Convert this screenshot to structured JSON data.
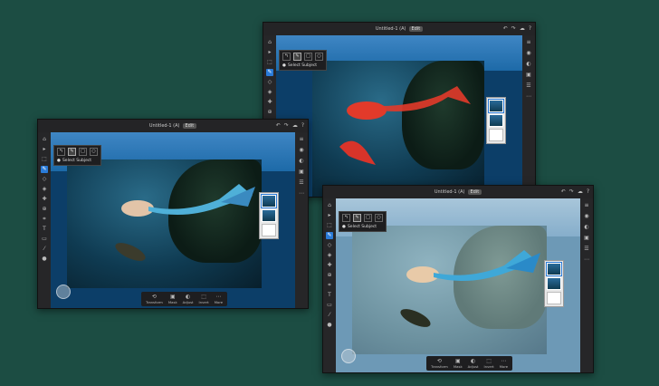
{
  "windows": [
    {
      "title": "Untitled-1 (A)",
      "badge": "Edit",
      "popup_label": "Select Subject",
      "bottom": [
        {
          "icon": "⟲",
          "label": "Transform"
        },
        {
          "icon": "▣",
          "label": "Mask"
        },
        {
          "icon": "◐",
          "label": "Adjust"
        },
        {
          "icon": "⬚",
          "label": "Invert"
        },
        {
          "icon": "⋯",
          "label": "More"
        }
      ]
    },
    {
      "title": "Untitled-1 (A)",
      "badge": "Edit",
      "popup_label": "Select Subject"
    },
    {
      "title": "Untitled-1 (A)",
      "badge": "Edit",
      "popup_label": "Select Subject",
      "bottom": [
        {
          "icon": "⟲",
          "label": "Transform"
        },
        {
          "icon": "▣",
          "label": "Mask"
        },
        {
          "icon": "◐",
          "label": "Adjust"
        },
        {
          "icon": "⬚",
          "label": "Invert"
        },
        {
          "icon": "⋯",
          "label": "More"
        }
      ]
    }
  ],
  "colors": {
    "background": "#1c4d43",
    "accent": "#2a7bd8",
    "mermaid_tail": "#4fb0d8",
    "selection_red": "#e23a2a"
  },
  "icons": {
    "toolbar": [
      "home-icon",
      "move-icon",
      "select-icon",
      "brush-icon",
      "eraser-icon",
      "fill-icon",
      "heal-icon",
      "clone-icon",
      "crop-icon",
      "type-icon",
      "place-icon",
      "eyedropper-icon",
      "color-icon"
    ],
    "titlebar": [
      "undo-icon",
      "redo-icon",
      "cloud-icon",
      "help-icon"
    ],
    "rightpanel": [
      "layers-icon",
      "visibility-icon",
      "adjust-icon",
      "mask-icon",
      "properties-icon",
      "more-icon"
    ]
  }
}
